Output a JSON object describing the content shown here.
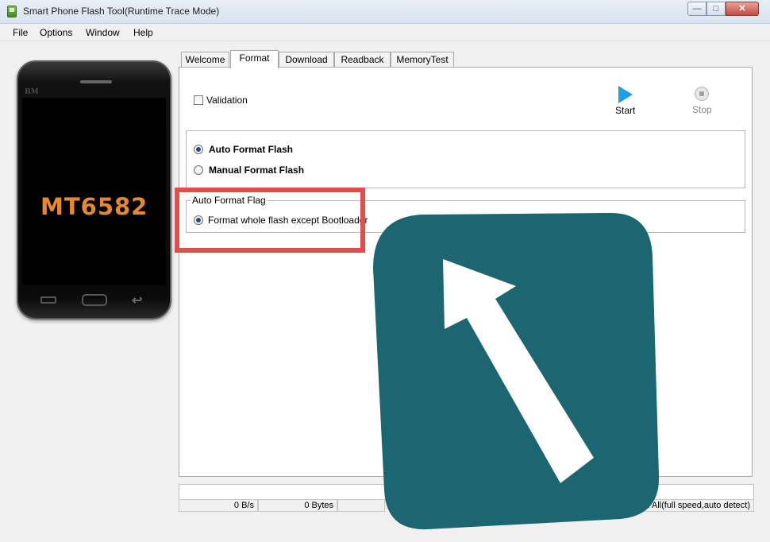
{
  "window": {
    "title": "Smart Phone Flash Tool(Runtime Trace Mode)",
    "controls": {
      "minimize": "—",
      "maximize": "□",
      "close": "✕"
    }
  },
  "menu": [
    "File",
    "Options",
    "Window",
    "Help"
  ],
  "phone": {
    "brand": "BM",
    "chip": "MT6582"
  },
  "tabs": [
    {
      "label": "Welcome",
      "active": false
    },
    {
      "label": "Format",
      "active": true
    },
    {
      "label": "Download",
      "active": false
    },
    {
      "label": "Readback",
      "active": false
    },
    {
      "label": "MemoryTest",
      "active": false
    }
  ],
  "format_tab": {
    "validation_label": "Validation",
    "validation_checked": false,
    "start_label": "Start",
    "stop_label": "Stop",
    "options": [
      {
        "label": "Auto Format Flash",
        "checked": true
      },
      {
        "label": "Manual Format Flash",
        "checked": false
      }
    ],
    "flag_group": {
      "title": "Auto Format Flag",
      "option": "Format whole flash except Bootloader",
      "checked": true
    }
  },
  "status": {
    "speed": "0 B/s",
    "bytes": "0 Bytes",
    "mode": "Download All(full speed,auto detect)"
  },
  "colors": {
    "highlight": "#e0504a",
    "overlay_tile": "#1b6670",
    "start_icon": "#1f9ee6",
    "chip_text": "#e48a2e"
  },
  "icons": {
    "overlay": "arrow-up-left-icon",
    "start": "play-icon",
    "stop": "stop-icon"
  }
}
